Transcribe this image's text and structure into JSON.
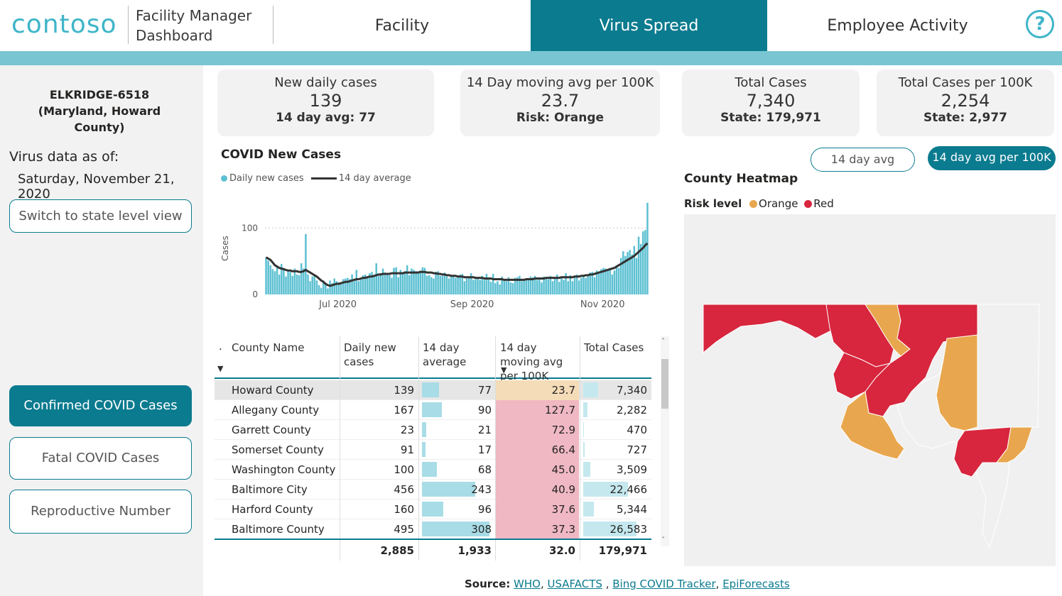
{
  "header": {
    "logo": "contoso",
    "app_title_line1": "Facility Manager",
    "app_title_line2": "Dashboard",
    "tabs": [
      {
        "label": "Facility"
      },
      {
        "label": "Virus Spread"
      },
      {
        "label": "Employee Activity"
      }
    ],
    "help_icon": "?"
  },
  "sidebar": {
    "location": "ELKRIDGE-6518 (Maryland, Howard County)",
    "asof_label": "Virus data as of:",
    "asof_date": "Saturday, November 21, 2020",
    "state_view_button": "Switch to state level view",
    "buttons": [
      {
        "label": "Confirmed COVID Cases"
      },
      {
        "label": "Fatal COVID Cases"
      },
      {
        "label": "Reproductive Number"
      }
    ]
  },
  "kpis": [
    {
      "title": "New daily cases",
      "value": "139",
      "sub": "14 day avg: 77"
    },
    {
      "title": "14 Day moving avg per 100K",
      "value": "23.7",
      "sub": "Risk: Orange"
    },
    {
      "title": "Total Cases",
      "value": "7,340",
      "sub": "State: 179,971"
    },
    {
      "title": "Total Cases per 100K",
      "value": "2,254",
      "sub": "State: 2,977"
    }
  ],
  "chart": {
    "title": "COVID New Cases",
    "legend_bars": "Daily new cases",
    "legend_line": "14 day average"
  },
  "chart_data": {
    "type": "bar",
    "title": "COVID New Cases",
    "ylabel": "Cases",
    "ylim": [
      0,
      140
    ],
    "yticks": [
      "0",
      "100"
    ],
    "xticks": [
      "Jul 2020",
      "Sep 2020",
      "Nov 2020"
    ],
    "series": [
      {
        "name": "Daily new cases",
        "values": [
          56,
          51,
          44,
          38,
          35,
          42,
          30,
          46,
          40,
          27,
          36,
          34,
          28,
          39,
          30,
          29,
          47,
          39,
          91,
          30,
          20,
          27,
          29,
          21,
          14,
          10,
          21,
          16,
          9,
          21,
          17,
          24,
          20,
          18,
          16,
          23,
          24,
          25,
          23,
          30,
          20,
          37,
          20,
          23,
          29,
          30,
          26,
          32,
          34,
          29,
          47,
          28,
          32,
          39,
          33,
          30,
          29,
          25,
          40,
          41,
          26,
          37,
          31,
          35,
          44,
          29,
          39,
          37,
          35,
          33,
          36,
          41,
          40,
          28,
          29,
          26,
          24,
          34,
          35,
          28,
          28,
          33,
          27,
          24,
          29,
          27,
          25,
          27,
          30,
          31,
          20,
          24,
          26,
          32,
          22,
          23,
          25,
          22,
          28,
          22,
          31,
          25,
          19,
          31,
          17,
          20,
          15,
          27,
          21,
          20,
          26,
          18,
          17,
          25,
          26,
          28,
          20,
          21,
          22,
          23,
          27,
          26,
          28,
          22,
          24,
          18,
          27,
          24,
          23,
          28,
          20,
          25,
          30,
          19,
          27,
          22,
          32,
          20,
          29,
          20,
          27,
          30,
          21,
          25,
          27,
          25,
          28,
          33,
          34,
          26,
          36,
          34,
          38,
          40,
          39,
          36,
          40,
          30,
          36,
          44,
          40,
          55,
          65,
          58,
          64,
          67,
          60,
          73,
          55,
          87,
          76,
          95,
          97,
          138
        ]
      },
      {
        "name": "14 day average",
        "values": [
          56,
          54,
          52,
          48,
          44,
          42,
          40,
          39,
          38,
          37,
          36,
          36,
          35,
          35,
          35,
          34,
          34,
          35,
          37,
          35,
          33,
          31,
          29,
          27,
          24,
          21,
          19,
          16,
          14,
          13,
          14,
          15,
          16,
          16,
          17,
          18,
          19,
          19,
          20,
          21,
          22,
          23,
          23,
          24,
          25,
          25,
          26,
          27,
          27,
          28,
          29,
          30,
          30,
          31,
          31,
          31,
          31,
          32,
          32,
          32,
          32,
          32,
          32,
          33,
          33,
          33,
          33,
          33,
          33,
          33,
          34,
          34,
          34,
          33,
          33,
          33,
          32,
          32,
          31,
          31,
          30,
          30,
          29,
          29,
          28,
          28,
          28,
          27,
          27,
          27,
          26,
          26,
          26,
          26,
          26,
          25,
          25,
          25,
          25,
          24,
          24,
          24,
          24,
          23,
          23,
          23,
          23,
          23,
          22,
          22,
          22,
          22,
          22,
          22,
          22,
          22,
          22,
          22,
          23,
          23,
          23,
          23,
          24,
          24,
          24,
          24,
          24,
          25,
          25,
          25,
          25,
          25,
          25,
          25,
          26,
          26,
          26,
          26,
          26,
          26,
          27,
          27,
          27,
          28,
          28,
          29,
          29,
          30,
          30,
          31,
          32,
          33,
          34,
          35,
          36,
          37,
          38,
          39,
          40,
          42,
          44,
          46,
          48,
          50,
          52,
          54,
          56,
          58,
          61,
          64,
          67,
          70,
          74,
          77
        ]
      }
    ]
  },
  "table": {
    "headers": [
      "County Name",
      "Daily new cases",
      "14 day average",
      "14 day moving avg per 100K",
      "Total Cases"
    ],
    "rows": [
      {
        "county": "Howard County",
        "daily": "139",
        "avg14": "77",
        "per100k": "23.7",
        "total": "7,340",
        "risk": "Orange"
      },
      {
        "county": "Allegany County",
        "daily": "167",
        "avg14": "90",
        "per100k": "127.7",
        "total": "2,282",
        "risk": "Red"
      },
      {
        "county": "Garrett County",
        "daily": "23",
        "avg14": "21",
        "per100k": "72.9",
        "total": "470",
        "risk": "Red"
      },
      {
        "county": "Somerset County",
        "daily": "91",
        "avg14": "17",
        "per100k": "66.4",
        "total": "727",
        "risk": "Red"
      },
      {
        "county": "Washington County",
        "daily": "100",
        "avg14": "68",
        "per100k": "45.0",
        "total": "3,509",
        "risk": "Red"
      },
      {
        "county": "Baltimore City",
        "daily": "456",
        "avg14": "243",
        "per100k": "40.9",
        "total": "22,466",
        "risk": "Red"
      },
      {
        "county": "Harford County",
        "daily": "160",
        "avg14": "96",
        "per100k": "37.6",
        "total": "5,344",
        "risk": "Red"
      },
      {
        "county": "Baltimore County",
        "daily": "495",
        "avg14": "308",
        "per100k": "37.3",
        "total": "26,583",
        "risk": "Red"
      }
    ],
    "avg14_values": [
      77,
      90,
      21,
      17,
      68,
      243,
      96,
      308
    ],
    "total_values": [
      7340,
      2282,
      470,
      727,
      3509,
      22466,
      5344,
      26583
    ],
    "totals": {
      "daily": "2,885",
      "avg14": "1,933",
      "per100k": "32.0",
      "total": "179,971"
    }
  },
  "map": {
    "toggle_left": "14 day avg",
    "toggle_right": "14 day avg per 100K",
    "title": "County Heatmap",
    "legend_label": "Risk level",
    "legend_items": [
      "Orange",
      "Red"
    ],
    "colors": {
      "orange": "#e8a74e",
      "red": "#d7263d",
      "land": "#f0f0f0"
    }
  },
  "source": {
    "label": "Source:",
    "links": [
      "WHO",
      "USAFACTS",
      "Bing COVID Tracker",
      "EpiForecasts"
    ]
  }
}
